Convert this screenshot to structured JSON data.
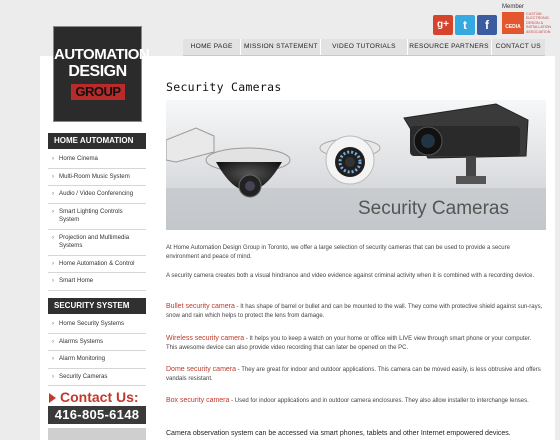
{
  "logo": {
    "line1": "AUTOMATION",
    "line2": "DESIGN",
    "line3": "GROUP"
  },
  "social": {
    "gplus": "g+",
    "twitter": "t",
    "facebook": "f"
  },
  "member": {
    "label": "Member",
    "badge": "CEDIA",
    "badge_text": "CUSTOM ELECTRONIC DESIGN & INSTALLATION ASSOCIATION"
  },
  "topnav": {
    "items": [
      "HOME PAGE",
      "MISSION STATEMENT",
      "VIDEO TUTORIALS",
      "RESOURCE PARTNERS",
      "CONTACT US"
    ]
  },
  "sidebar": {
    "home_automation": {
      "heading": "HOME AUTOMATION",
      "items": [
        "Home Cinema",
        "Multi-Room Music System",
        "Audio / Video Conferencing",
        "Smart Lighting Controls System",
        "Projection and Multimedia Systems",
        "Home Automation & Control",
        "Smart Home"
      ]
    },
    "security_system": {
      "heading": "SECURITY SYSTEM",
      "items": [
        "Home Security Systems",
        "Alarms Systems",
        "Alarm Monitoring",
        "Security Cameras"
      ]
    },
    "contact": {
      "heading": "Contact Us:",
      "phone": "416-805-6148"
    }
  },
  "main": {
    "title": "Security Cameras",
    "hero_caption": "Security Cameras",
    "intro": "At Home Automation Design Group in Toronto, we offer a large selection of security cameras that can be used to provide a secure environment and peace of mind.",
    "intro2": "A security camera creates both a visual hindrance and video evidence against criminal activity when it is combined with a recording device.",
    "sections": [
      {
        "name": "Bullet security camera",
        "text": " - It has shape of barrel or bullet and can be mounted to the wall. They come with protective shield against sun-rays, snow and rain which helps to protect the lens from damage."
      },
      {
        "name": "Wireless security camera",
        "text": " - It helps you to keep a watch on your home or office with LIVE view through smart phone or your computer. This awesome device can also provide video recording that can later be opened on the PC."
      },
      {
        "name": "Dome security camera",
        "text": " - They are great for indoor and outdoor applications. This camera can be moved easily, is less obtrusive and offers vandals resistant."
      },
      {
        "name": "Box security camera",
        "text": " - Used for indoor applications and in outdoor camera enclosures. They also allow installer to interchange lenses."
      }
    ],
    "closing": "Camera observation system can be accessed via smart phones, tablets and other Internet empowered devices."
  },
  "colors": {
    "accent_red": "#c0392b",
    "sidebar_header": "#303030",
    "nav_bg": "#e2e2e2"
  }
}
